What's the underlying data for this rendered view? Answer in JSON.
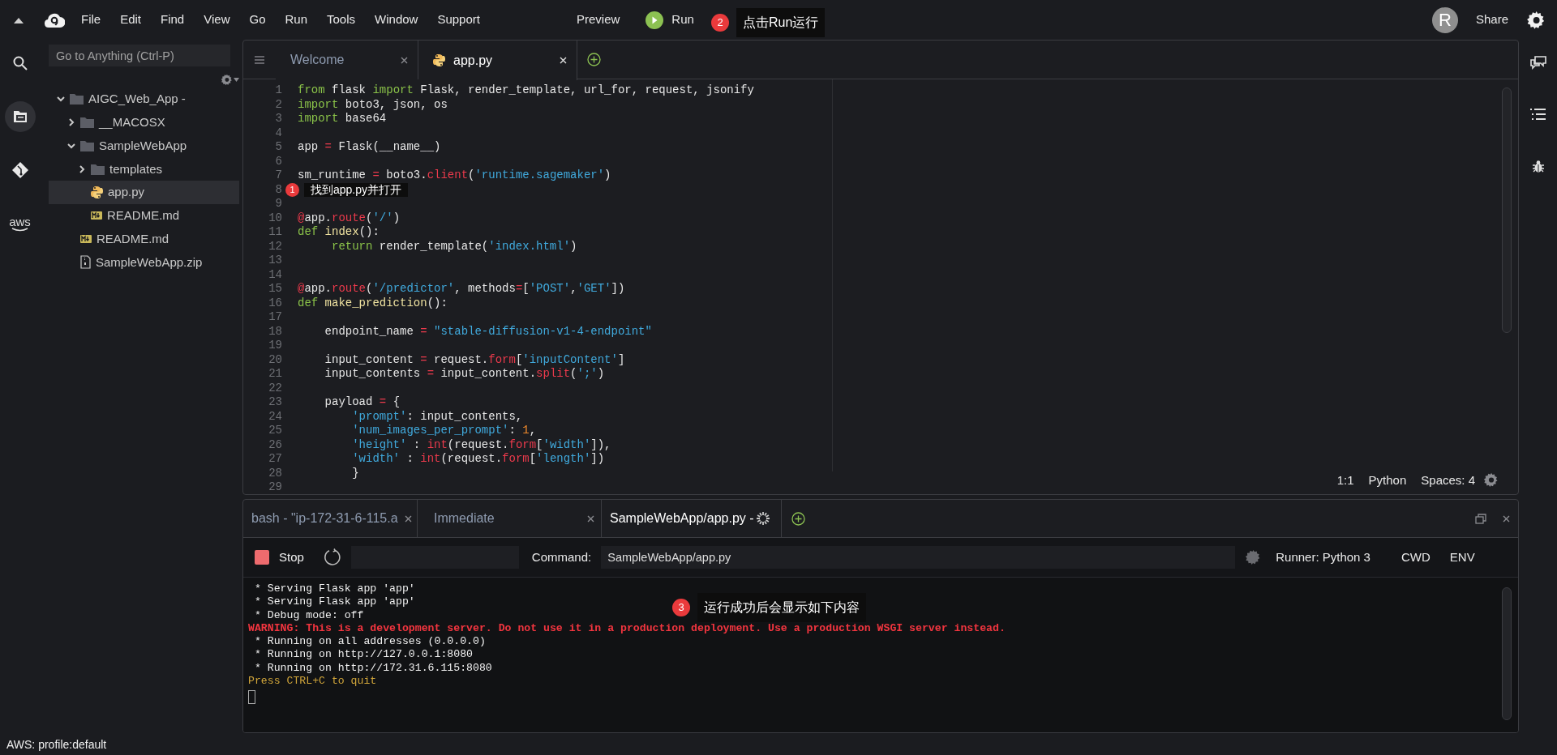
{
  "menu_bar": {
    "menus": [
      "File",
      "Edit",
      "Find",
      "View",
      "Go",
      "Run",
      "Tools",
      "Window",
      "Support"
    ],
    "preview": "Preview",
    "run": "Run",
    "avatar": "R",
    "share": "Share"
  },
  "activity_bar": {
    "items": [
      {
        "kind": "search",
        "selected": false
      },
      {
        "kind": "files",
        "selected": true
      },
      {
        "kind": "git",
        "selected": false
      },
      {
        "kind": "aws",
        "label": "aws",
        "selected": false
      }
    ]
  },
  "file_tree": {
    "search_placeholder": "Go to Anything (Ctrl-P)",
    "items": [
      {
        "name": "AIGC_Web_App -",
        "kind": "folder",
        "expanded": true,
        "selected": false,
        "children": [
          {
            "name": "__MACOSX",
            "kind": "folder",
            "expanded": false,
            "selected": false
          },
          {
            "name": "SampleWebApp",
            "kind": "folder",
            "expanded": true,
            "selected": false,
            "children": [
              {
                "name": "templates",
                "kind": "folder",
                "expanded": false,
                "selected": false
              },
              {
                "name": "app.py",
                "kind": "python",
                "selected": true
              },
              {
                "name": "README.md",
                "kind": "markdown",
                "selected": false
              }
            ]
          },
          {
            "name": "README.md",
            "kind": "markdown",
            "selected": false
          },
          {
            "name": "SampleWebApp.zip",
            "kind": "zip",
            "selected": false
          }
        ]
      }
    ]
  },
  "editor": {
    "tabs": [
      {
        "label": "Welcome",
        "kind": "text",
        "selected": false
      },
      {
        "label": "app.py",
        "kind": "python",
        "selected": true
      }
    ],
    "lines": [
      {
        "n": "1",
        "segments": [
          {
            "kind": "keyword",
            "text": "from"
          },
          {
            "kind": "plain",
            "text": " flask "
          },
          {
            "kind": "keyword",
            "text": "import"
          },
          {
            "kind": "plain",
            "text": " Flask, render_template, url_for, request, jsonify"
          }
        ]
      },
      {
        "n": "2",
        "segments": [
          {
            "kind": "keyword",
            "text": "import"
          },
          {
            "kind": "plain",
            "text": " boto3, json, os"
          }
        ]
      },
      {
        "n": "3",
        "segments": [
          {
            "kind": "keyword",
            "text": "import"
          },
          {
            "kind": "plain",
            "text": " base64"
          }
        ]
      },
      {
        "n": "4"
      },
      {
        "n": "5",
        "segments": [
          {
            "kind": "plain",
            "text": "app "
          },
          {
            "kind": "operator",
            "text": "="
          },
          {
            "kind": "plain",
            "text": " Flask(__name__)"
          }
        ]
      },
      {
        "n": "6"
      },
      {
        "n": "7",
        "segments": [
          {
            "kind": "plain",
            "text": "sm_runtime "
          },
          {
            "kind": "operator",
            "text": "="
          },
          {
            "kind": "plain",
            "text": " boto3."
          },
          {
            "kind": "call",
            "text": "client"
          },
          {
            "kind": "plain",
            "text": "("
          },
          {
            "kind": "string",
            "text": "'runtime.sagemaker'"
          },
          {
            "kind": "plain",
            "text": ")"
          }
        ]
      },
      {
        "n": "8"
      },
      {
        "n": "9"
      },
      {
        "n": "10",
        "segments": [
          {
            "kind": "operator",
            "text": "@"
          },
          {
            "kind": "plain",
            "text": "app."
          },
          {
            "kind": "call",
            "text": "route"
          },
          {
            "kind": "plain",
            "text": "("
          },
          {
            "kind": "string",
            "text": "'/'"
          },
          {
            "kind": "plain",
            "text": ")"
          }
        ]
      },
      {
        "n": "11",
        "segments": [
          {
            "kind": "keyword",
            "text": "def "
          },
          {
            "kind": "name",
            "text": "index"
          },
          {
            "kind": "plain",
            "text": "():"
          }
        ]
      },
      {
        "n": "12",
        "segments": [
          {
            "kind": "keyword",
            "text": "     return"
          },
          {
            "kind": "plain",
            "text": " render_template("
          },
          {
            "kind": "string",
            "text": "'index.html'"
          },
          {
            "kind": "plain",
            "text": ")"
          }
        ]
      },
      {
        "n": "13"
      },
      {
        "n": "14"
      },
      {
        "n": "15",
        "segments": [
          {
            "kind": "operator",
            "text": "@"
          },
          {
            "kind": "plain",
            "text": "app."
          },
          {
            "kind": "call",
            "text": "route"
          },
          {
            "kind": "plain",
            "text": "("
          },
          {
            "kind": "string",
            "text": "'/predictor'"
          },
          {
            "kind": "plain",
            "text": ", methods"
          },
          {
            "kind": "operator",
            "text": "="
          },
          {
            "kind": "plain",
            "text": "["
          },
          {
            "kind": "string",
            "text": "'POST'"
          },
          {
            "kind": "plain",
            "text": ","
          },
          {
            "kind": "string",
            "text": "'GET'"
          },
          {
            "kind": "plain",
            "text": "])"
          }
        ]
      },
      {
        "n": "16",
        "segments": [
          {
            "kind": "keyword",
            "text": "def "
          },
          {
            "kind": "name",
            "text": "make_prediction"
          },
          {
            "kind": "plain",
            "text": "():"
          }
        ]
      },
      {
        "n": "17"
      },
      {
        "n": "18",
        "segments": [
          {
            "kind": "plain",
            "text": "    endpoint_name "
          },
          {
            "kind": "operator",
            "text": "="
          },
          {
            "kind": "string",
            "text": " \"stable-diffusion-v1-4-endpoint\""
          }
        ]
      },
      {
        "n": "19"
      },
      {
        "n": "20",
        "segments": [
          {
            "kind": "plain",
            "text": "    input_content "
          },
          {
            "kind": "operator",
            "text": "="
          },
          {
            "kind": "plain",
            "text": " request."
          },
          {
            "kind": "call",
            "text": "form"
          },
          {
            "kind": "plain",
            "text": "["
          },
          {
            "kind": "string",
            "text": "'inputContent'"
          },
          {
            "kind": "plain",
            "text": "]"
          }
        ]
      },
      {
        "n": "21",
        "segments": [
          {
            "kind": "plain",
            "text": "    input_contents "
          },
          {
            "kind": "operator",
            "text": "="
          },
          {
            "kind": "plain",
            "text": " input_content."
          },
          {
            "kind": "call",
            "text": "split"
          },
          {
            "kind": "plain",
            "text": "("
          },
          {
            "kind": "string",
            "text": "';'"
          },
          {
            "kind": "plain",
            "text": ")"
          }
        ]
      },
      {
        "n": "22"
      },
      {
        "n": "23",
        "segments": [
          {
            "kind": "plain",
            "text": "    payload "
          },
          {
            "kind": "operator",
            "text": "="
          },
          {
            "kind": "plain",
            "text": " {"
          }
        ]
      },
      {
        "n": "24",
        "segments": [
          {
            "kind": "string",
            "text": "        'prompt'"
          },
          {
            "kind": "plain",
            "text": ": input_contents,"
          }
        ]
      },
      {
        "n": "25",
        "segments": [
          {
            "kind": "string",
            "text": "        'num_images_per_prompt'"
          },
          {
            "kind": "plain",
            "text": ": "
          },
          {
            "kind": "number",
            "text": "1"
          },
          {
            "kind": "plain",
            "text": ","
          }
        ]
      },
      {
        "n": "26",
        "segments": [
          {
            "kind": "string",
            "text": "        'height'"
          },
          {
            "kind": "plain",
            "text": " : "
          },
          {
            "kind": "call",
            "text": "int"
          },
          {
            "kind": "plain",
            "text": "(request."
          },
          {
            "kind": "call",
            "text": "form"
          },
          {
            "kind": "plain",
            "text": "["
          },
          {
            "kind": "string",
            "text": "'width'"
          },
          {
            "kind": "plain",
            "text": "]),"
          }
        ]
      },
      {
        "n": "27",
        "segments": [
          {
            "kind": "string",
            "text": "        'width'"
          },
          {
            "kind": "plain",
            "text": " : "
          },
          {
            "kind": "call",
            "text": "int"
          },
          {
            "kind": "plain",
            "text": "(request."
          },
          {
            "kind": "call",
            "text": "form"
          },
          {
            "kind": "plain",
            "text": "["
          },
          {
            "kind": "string",
            "text": "'length'"
          },
          {
            "kind": "plain",
            "text": "])"
          }
        ]
      },
      {
        "n": "28",
        "segments": [
          {
            "kind": "plain",
            "text": "        }"
          }
        ]
      },
      {
        "n": "29"
      }
    ],
    "status": {
      "position": "1:1",
      "language": "Python",
      "indent": "Spaces: 4"
    }
  },
  "console": {
    "tabs": [
      {
        "label": "bash - \"ip-172-31-6-115.a",
        "kind": "terminal",
        "selected": false
      },
      {
        "label": "Immediate",
        "kind": "immediate",
        "selected": false
      },
      {
        "label": "SampleWebApp/app.py -",
        "kind": "runner",
        "selected": true
      }
    ],
    "toolbar": {
      "stop": "Stop",
      "command_label": "Command:",
      "command": "SampleWebApp/app.py",
      "runner": "Runner: Python 3",
      "cwd": "CWD",
      "env": "ENV"
    },
    "output": [
      {
        "kind": "normal",
        "text": " * Serving Flask app 'app'"
      },
      {
        "kind": "normal",
        "text": " * Serving Flask app 'app'"
      },
      {
        "kind": "normal",
        "text": " * Debug mode: off"
      },
      {
        "kind": "warning",
        "text": "WARNING: This is a development server. Do not use it in a production deployment. Use a production WSGI server instead."
      },
      {
        "kind": "normal",
        "text": " * Running on all addresses (0.0.0.0)"
      },
      {
        "kind": "normal",
        "text": " * Running on http://127.0.0.1:8080"
      },
      {
        "kind": "normal",
        "text": " * Running on http://172.31.6.115:8080"
      },
      {
        "kind": "hint",
        "text": "Press CTRL+C to quit"
      }
    ]
  },
  "status_bar": "AWS: profile:default",
  "annotations": [
    {
      "number": "1",
      "text": "找到app.py并打开"
    },
    {
      "number": "2",
      "text": "点击Run运行"
    },
    {
      "number": "3",
      "text": "运行成功后会显示如下内容"
    }
  ]
}
